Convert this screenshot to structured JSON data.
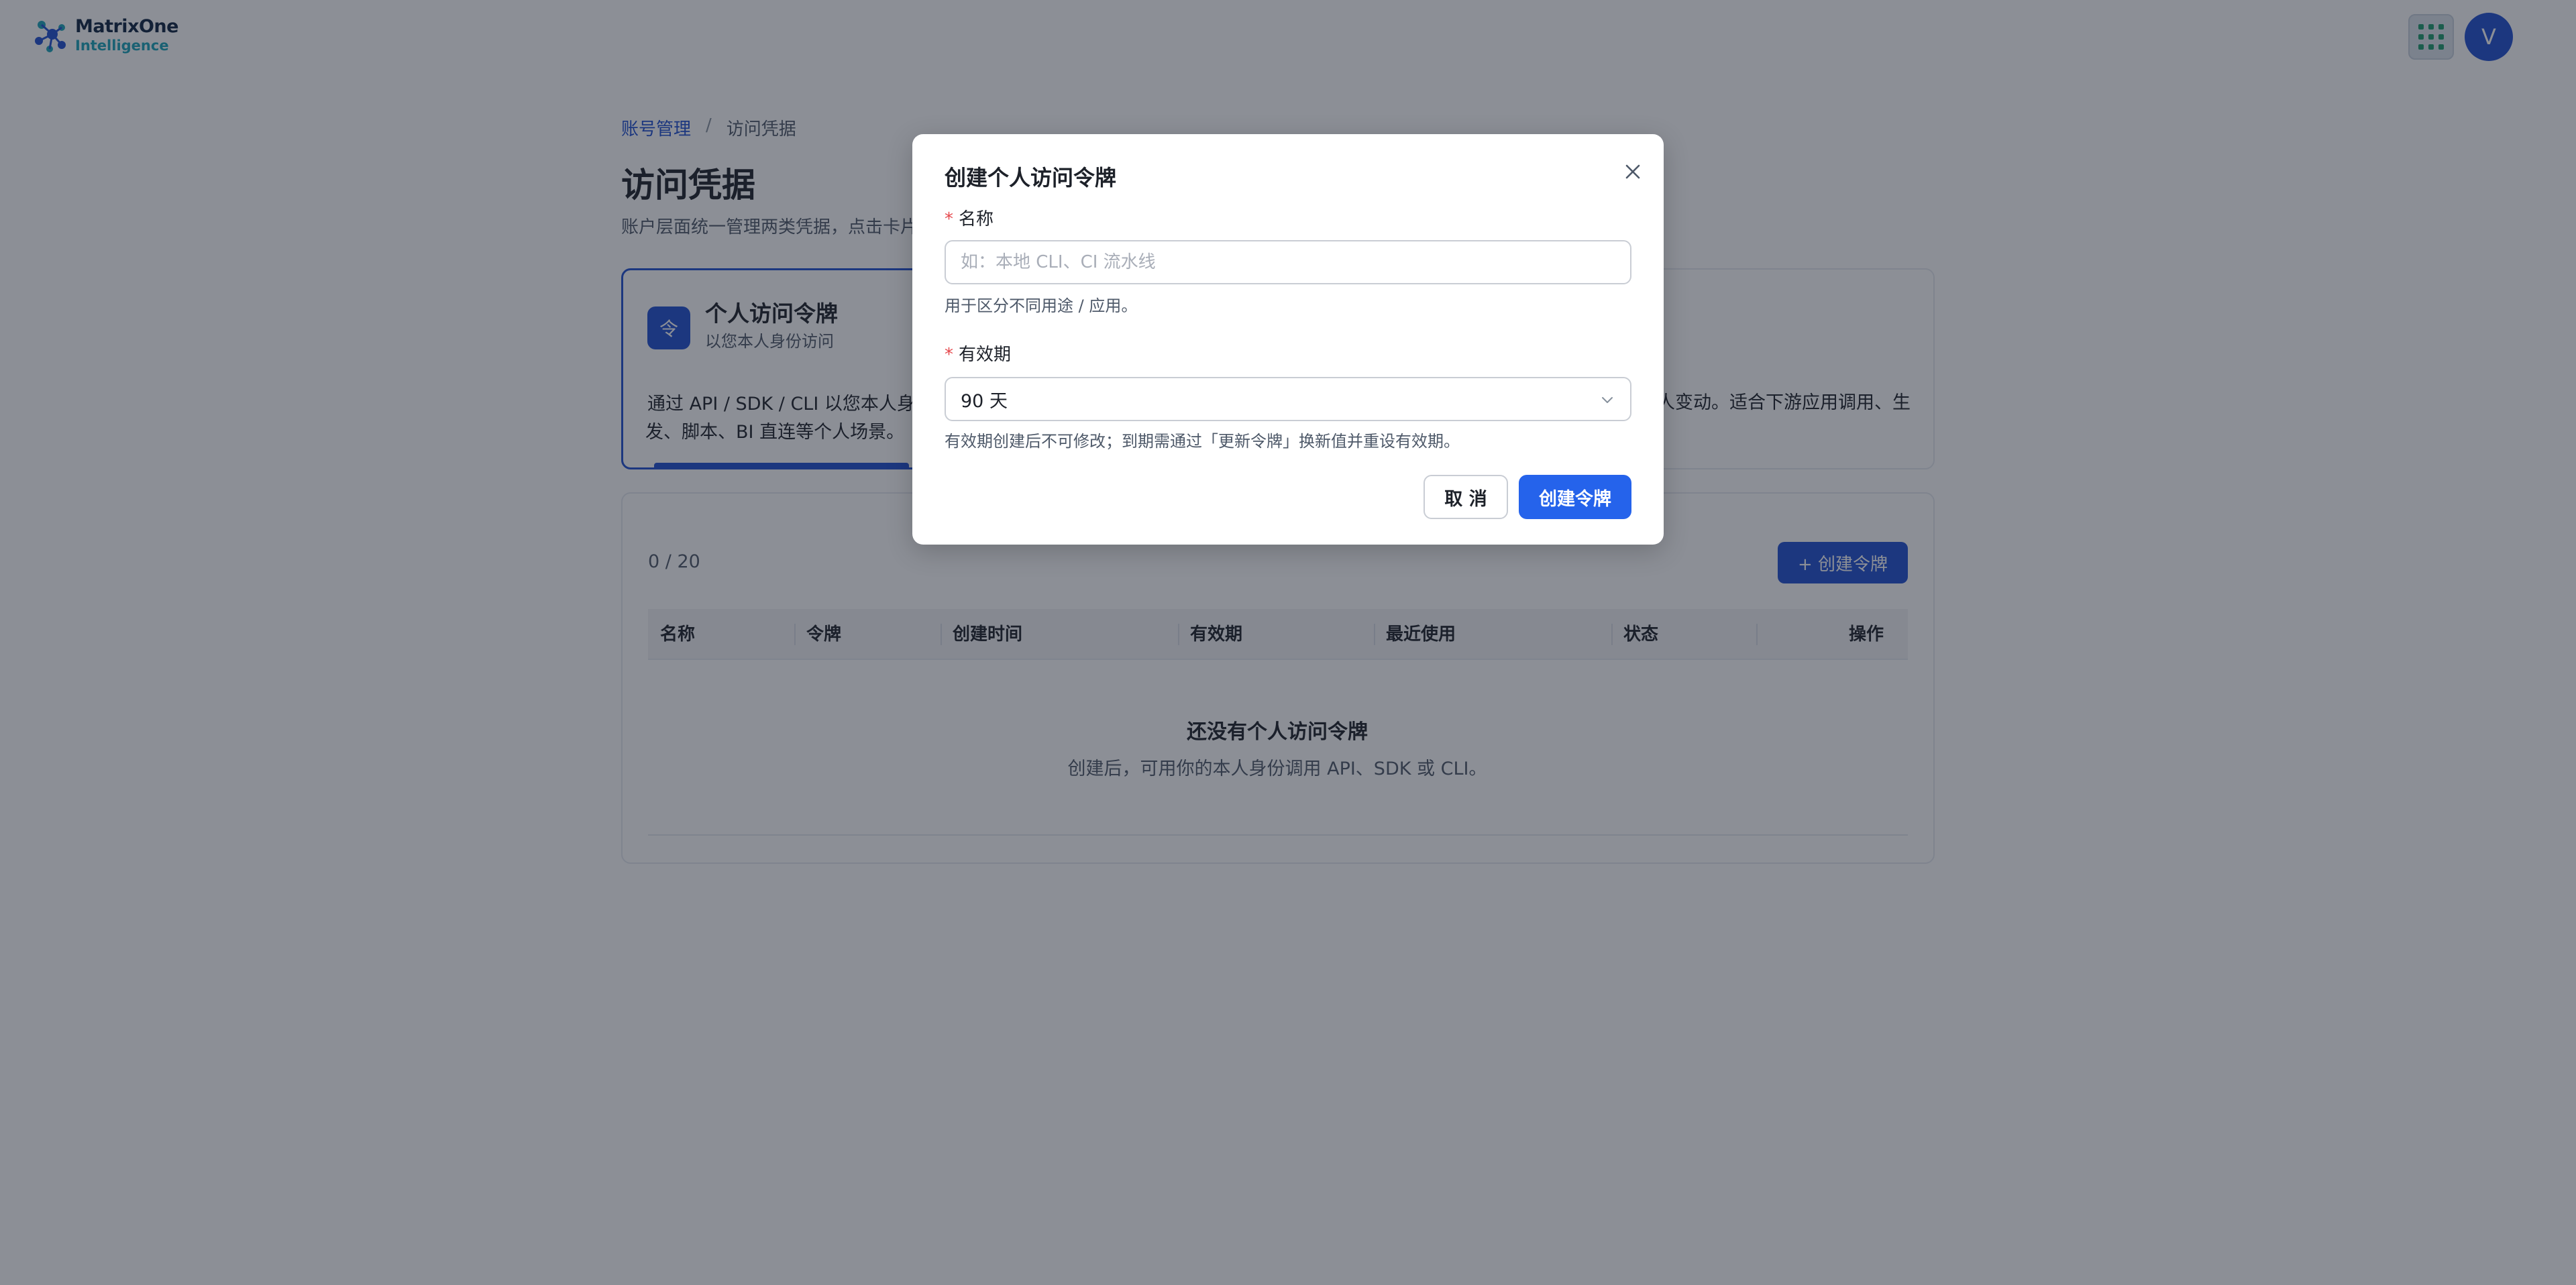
{
  "header": {
    "logo_name": "MatrixOne",
    "logo_sub": "Intelligence",
    "apps_icon": "grid-icon",
    "avatar_letter": "V"
  },
  "breadcrumb": {
    "parent": "账号管理",
    "separator": "/",
    "current": "访问凭据"
  },
  "page": {
    "title": "访问凭据",
    "description": "账户层面统一管理两类凭据，点击卡片"
  },
  "card": {
    "icon_glyph": "令",
    "title": "个人访问令牌",
    "subtitle": "以您本人身份访问",
    "body_start": "通过 API / SDK / CLI 以您本人身",
    "body_right": "人变动。适合下游应用调用、生",
    "body_line2": "发、脚本、BI 直连等个人场景。"
  },
  "panel": {
    "count": "0 / 20",
    "create_button": "+ 创建令牌",
    "columns": [
      "名称",
      "令牌",
      "创建时间",
      "有效期",
      "最近使用",
      "状态",
      "操作"
    ],
    "empty_title": "还没有个人访问令牌",
    "empty_desc": "创建后，可用你的本人身份调用 API、SDK 或 CLI。"
  },
  "modal": {
    "title": "创建个人访问令牌",
    "close_icon": "close-icon",
    "name_label": "名称",
    "name_placeholder": "如：本地 CLI、CI 流水线",
    "name_value": "",
    "name_hint": "用于区分不同用途 / 应用。",
    "expiry_label": "有效期",
    "expiry_value": "90 天",
    "expiry_hint": "有效期创建后不可修改；到期需通过「更新令牌」换新值并重设有效期。",
    "required_mark": "*",
    "cancel_label": "取 消",
    "create_label": "创建令牌"
  },
  "colors": {
    "primary": "#1f4fd1",
    "primary_button": "#2563eb",
    "required": "#e5484d",
    "overlay": "rgba(25,32,45,0.5)"
  }
}
